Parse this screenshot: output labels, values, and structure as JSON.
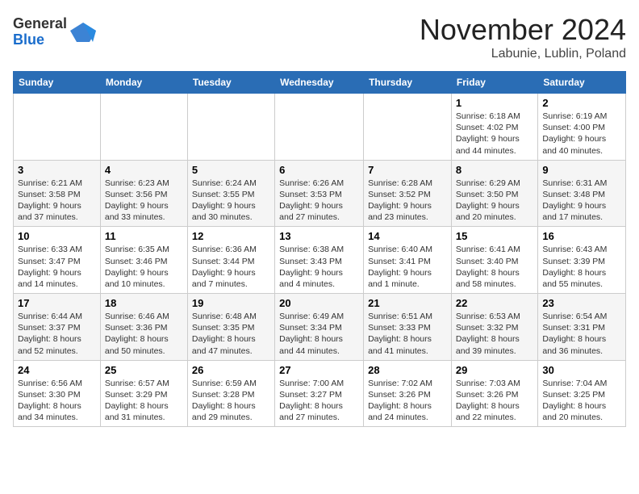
{
  "logo": {
    "general": "General",
    "blue": "Blue"
  },
  "title": "November 2024",
  "location": "Labunie, Lublin, Poland",
  "days_of_week": [
    "Sunday",
    "Monday",
    "Tuesday",
    "Wednesday",
    "Thursday",
    "Friday",
    "Saturday"
  ],
  "weeks": [
    [
      {
        "day": "",
        "detail": ""
      },
      {
        "day": "",
        "detail": ""
      },
      {
        "day": "",
        "detail": ""
      },
      {
        "day": "",
        "detail": ""
      },
      {
        "day": "",
        "detail": ""
      },
      {
        "day": "1",
        "detail": "Sunrise: 6:18 AM\nSunset: 4:02 PM\nDaylight: 9 hours and 44 minutes."
      },
      {
        "day": "2",
        "detail": "Sunrise: 6:19 AM\nSunset: 4:00 PM\nDaylight: 9 hours and 40 minutes."
      }
    ],
    [
      {
        "day": "3",
        "detail": "Sunrise: 6:21 AM\nSunset: 3:58 PM\nDaylight: 9 hours and 37 minutes."
      },
      {
        "day": "4",
        "detail": "Sunrise: 6:23 AM\nSunset: 3:56 PM\nDaylight: 9 hours and 33 minutes."
      },
      {
        "day": "5",
        "detail": "Sunrise: 6:24 AM\nSunset: 3:55 PM\nDaylight: 9 hours and 30 minutes."
      },
      {
        "day": "6",
        "detail": "Sunrise: 6:26 AM\nSunset: 3:53 PM\nDaylight: 9 hours and 27 minutes."
      },
      {
        "day": "7",
        "detail": "Sunrise: 6:28 AM\nSunset: 3:52 PM\nDaylight: 9 hours and 23 minutes."
      },
      {
        "day": "8",
        "detail": "Sunrise: 6:29 AM\nSunset: 3:50 PM\nDaylight: 9 hours and 20 minutes."
      },
      {
        "day": "9",
        "detail": "Sunrise: 6:31 AM\nSunset: 3:48 PM\nDaylight: 9 hours and 17 minutes."
      }
    ],
    [
      {
        "day": "10",
        "detail": "Sunrise: 6:33 AM\nSunset: 3:47 PM\nDaylight: 9 hours and 14 minutes."
      },
      {
        "day": "11",
        "detail": "Sunrise: 6:35 AM\nSunset: 3:46 PM\nDaylight: 9 hours and 10 minutes."
      },
      {
        "day": "12",
        "detail": "Sunrise: 6:36 AM\nSunset: 3:44 PM\nDaylight: 9 hours and 7 minutes."
      },
      {
        "day": "13",
        "detail": "Sunrise: 6:38 AM\nSunset: 3:43 PM\nDaylight: 9 hours and 4 minutes."
      },
      {
        "day": "14",
        "detail": "Sunrise: 6:40 AM\nSunset: 3:41 PM\nDaylight: 9 hours and 1 minute."
      },
      {
        "day": "15",
        "detail": "Sunrise: 6:41 AM\nSunset: 3:40 PM\nDaylight: 8 hours and 58 minutes."
      },
      {
        "day": "16",
        "detail": "Sunrise: 6:43 AM\nSunset: 3:39 PM\nDaylight: 8 hours and 55 minutes."
      }
    ],
    [
      {
        "day": "17",
        "detail": "Sunrise: 6:44 AM\nSunset: 3:37 PM\nDaylight: 8 hours and 52 minutes."
      },
      {
        "day": "18",
        "detail": "Sunrise: 6:46 AM\nSunset: 3:36 PM\nDaylight: 8 hours and 50 minutes."
      },
      {
        "day": "19",
        "detail": "Sunrise: 6:48 AM\nSunset: 3:35 PM\nDaylight: 8 hours and 47 minutes."
      },
      {
        "day": "20",
        "detail": "Sunrise: 6:49 AM\nSunset: 3:34 PM\nDaylight: 8 hours and 44 minutes."
      },
      {
        "day": "21",
        "detail": "Sunrise: 6:51 AM\nSunset: 3:33 PM\nDaylight: 8 hours and 41 minutes."
      },
      {
        "day": "22",
        "detail": "Sunrise: 6:53 AM\nSunset: 3:32 PM\nDaylight: 8 hours and 39 minutes."
      },
      {
        "day": "23",
        "detail": "Sunrise: 6:54 AM\nSunset: 3:31 PM\nDaylight: 8 hours and 36 minutes."
      }
    ],
    [
      {
        "day": "24",
        "detail": "Sunrise: 6:56 AM\nSunset: 3:30 PM\nDaylight: 8 hours and 34 minutes."
      },
      {
        "day": "25",
        "detail": "Sunrise: 6:57 AM\nSunset: 3:29 PM\nDaylight: 8 hours and 31 minutes."
      },
      {
        "day": "26",
        "detail": "Sunrise: 6:59 AM\nSunset: 3:28 PM\nDaylight: 8 hours and 29 minutes."
      },
      {
        "day": "27",
        "detail": "Sunrise: 7:00 AM\nSunset: 3:27 PM\nDaylight: 8 hours and 27 minutes."
      },
      {
        "day": "28",
        "detail": "Sunrise: 7:02 AM\nSunset: 3:26 PM\nDaylight: 8 hours and 24 minutes."
      },
      {
        "day": "29",
        "detail": "Sunrise: 7:03 AM\nSunset: 3:26 PM\nDaylight: 8 hours and 22 minutes."
      },
      {
        "day": "30",
        "detail": "Sunrise: 7:04 AM\nSunset: 3:25 PM\nDaylight: 8 hours and 20 minutes."
      }
    ]
  ]
}
